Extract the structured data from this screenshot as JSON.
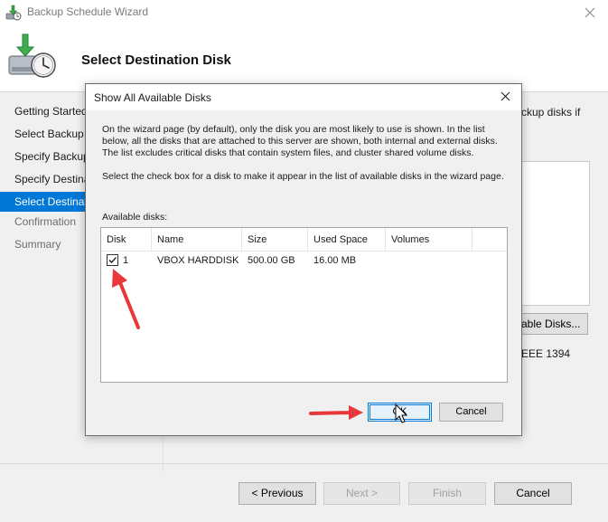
{
  "wizard": {
    "title": "Backup Schedule Wizard",
    "header_title": "Select Destination Disk",
    "steps": [
      {
        "label": "Getting Started",
        "state": "normal"
      },
      {
        "label": "Select Backup Configuration",
        "state": "normal"
      },
      {
        "label": "Specify Backup Time",
        "state": "normal"
      },
      {
        "label": "Specify Destination Type",
        "state": "normal"
      },
      {
        "label": "Select Destination Disk",
        "state": "active"
      },
      {
        "label": "Confirmation",
        "state": "disabled"
      },
      {
        "label": "Summary",
        "state": "disabled"
      }
    ],
    "behind": {
      "text_partial": "ckup disks if",
      "button_partial": "able Disks...",
      "text_partial_2": "EEE 1394"
    },
    "buttons": {
      "previous": "< Previous",
      "next": "Next >",
      "finish": "Finish",
      "cancel": "Cancel"
    }
  },
  "dialog": {
    "title": "Show All Available Disks",
    "desc_p1": "On the wizard page (by default), only the disk you are most likely to use is shown. In the list below, all the disks that are attached to this server are shown, both internal and external disks. The list excludes critical disks that contain system files, and cluster shared volume disks.",
    "desc_p2": "Select the check box for a disk to make it appear in the list of available disks in the wizard page.",
    "list_label": "Available disks:",
    "columns": [
      "Disk",
      "Name",
      "Size",
      "Used Space",
      "Volumes"
    ],
    "rows": [
      {
        "checked": true,
        "disk": "1",
        "name": "VBOX HARDDISK",
        "size": "500.00 GB",
        "used": "16.00 MB",
        "volumes": ""
      }
    ],
    "ok_label": "OK",
    "cancel_label": "Cancel"
  },
  "colors": {
    "accent": "#0078d7",
    "annotation_arrow": "#e8383b"
  },
  "icons": {
    "wizard_title": "backup-schedule-icon",
    "wizard_header": "backup-disk-clock-icon",
    "close": "close-icon",
    "checkbox": "checkmark-icon",
    "arrow": "red-arrow-icon",
    "cursor": "mouse-pointer-icon"
  }
}
